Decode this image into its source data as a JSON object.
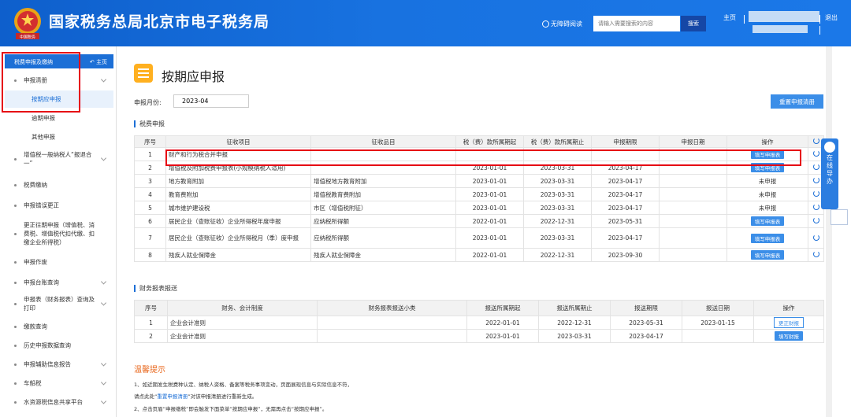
{
  "header": {
    "title": "国家税务总局北京市电子税务局",
    "emblem_text": "中国税务",
    "accessibility": "无障碍阅读",
    "search_placeholder": "请输入需要搜索的内容",
    "search_button": "搜索",
    "home": "主页",
    "logout": "退出"
  },
  "sidebar": {
    "head": "税费申报及缴纳",
    "home": "主页",
    "items": [
      {
        "label": "申报清册",
        "chevron": true
      },
      {
        "label": "增值税一般纳税人“报退合一”",
        "chevron": true
      },
      {
        "label": "税费缴纳",
        "chevron": false
      },
      {
        "label": "申报错误更正",
        "chevron": false
      },
      {
        "label": "更正往期申报（增值税、消费税、增值税代扣代缴、扣缴企业所得税）",
        "chevron": false
      },
      {
        "label": "申报作废",
        "chevron": false
      },
      {
        "label": "申报台账查询",
        "chevron": true
      },
      {
        "label": "申报表（财务报表）查询及打印",
        "chevron": true
      },
      {
        "label": "缴款查询",
        "chevron": false
      },
      {
        "label": "历史申报数据查询",
        "chevron": false
      },
      {
        "label": "申报辅助信息报告",
        "chevron": true
      },
      {
        "label": "车船税",
        "chevron": true
      },
      {
        "label": "水资源税信息共享平台",
        "chevron": true
      }
    ],
    "subitems": [
      "按期应申报",
      "逾期申报",
      "其他申报"
    ]
  },
  "main": {
    "title": "按期应申报",
    "month_label": "申报月份:",
    "month_value": "2023-04",
    "reset_button": "重置申报清册",
    "tax_section": "税费申报",
    "tax_headers": [
      "序号",
      "征收项目",
      "征收品目",
      "税（费）款所属期起",
      "税（费）款所属期止",
      "申报期限",
      "申报日期",
      "操作"
    ],
    "tax_rows": [
      {
        "no": "1",
        "item": "财产和行为税合并申报",
        "sub": "",
        "start": "",
        "end": "",
        "deadline": "",
        "date": "",
        "op": "填写申报表",
        "op_type": "button"
      },
      {
        "no": "2",
        "item": "增值税及附加税费申报表(小规模纳税人适用)",
        "sub": "",
        "start": "2023-01-01",
        "end": "2023-03-31",
        "deadline": "2023-04-17",
        "date": "",
        "op": "填写申报表",
        "op_type": "button"
      },
      {
        "no": "3",
        "item": "地方教育附加",
        "sub": "增值税地方教育附加",
        "start": "2023-01-01",
        "end": "2023-03-31",
        "deadline": "2023-04-17",
        "date": "",
        "op": "未申报",
        "op_type": "text"
      },
      {
        "no": "4",
        "item": "教育费附加",
        "sub": "增值税教育费附加",
        "start": "2023-01-01",
        "end": "2023-03-31",
        "deadline": "2023-04-17",
        "date": "",
        "op": "未申报",
        "op_type": "text"
      },
      {
        "no": "5",
        "item": "城市维护建设税",
        "sub": "市区（增值税附征）",
        "start": "2023-01-01",
        "end": "2023-03-31",
        "deadline": "2023-04-17",
        "date": "",
        "op": "未申报",
        "op_type": "text"
      },
      {
        "no": "6",
        "item": "居民企业（查账征收）企业所得税年度申报",
        "sub": "应纳税所得额",
        "start": "2022-01-01",
        "end": "2022-12-31",
        "deadline": "2023-05-31",
        "date": "",
        "op": "填写申报表",
        "op_type": "button"
      },
      {
        "no": "7",
        "item": "居民企业（查账征收）企业所得税月（季）度申报",
        "sub": "应纳税所得额",
        "start": "2023-01-01",
        "end": "2023-03-31",
        "deadline": "2023-04-17",
        "date": "",
        "op": "填写申报表",
        "op_type": "button"
      },
      {
        "no": "8",
        "item": "残疾人就业保障金",
        "sub": "残疾人就业保障金",
        "start": "2022-01-01",
        "end": "2022-12-31",
        "deadline": "2023-09-30",
        "date": "",
        "op": "填写申报表",
        "op_type": "button"
      }
    ],
    "fin_section": "财务报表报送",
    "fin_headers": [
      "序号",
      "财务、会计制度",
      "财务报表报送小类",
      "报送所属期起",
      "报送所属期止",
      "报送期限",
      "报送日期",
      "操作"
    ],
    "fin_rows": [
      {
        "no": "1",
        "system": "企业会计准则",
        "sub": "",
        "start": "2022-01-01",
        "end": "2022-12-31",
        "deadline": "2023-05-31",
        "date": "2023-01-15",
        "op": "更正财报",
        "op_type": "outline"
      },
      {
        "no": "2",
        "system": "企业会计准则",
        "sub": "",
        "start": "2023-01-01",
        "end": "2023-03-31",
        "deadline": "2023-04-17",
        "date": "",
        "op": "填写财报",
        "op_type": "button"
      }
    ],
    "tips_title": "温馨提示",
    "tips": [
      {
        "pre": "1、如近期发生税费种认定、纳税人资格、备案等税务事项变动，页面展现信息与实际信息不符，",
        "link": "",
        "post": ""
      },
      {
        "pre": "请点此处“",
        "link": "重置申报清册",
        "post": "”对该申报清册进行重新生成。"
      },
      {
        "pre": "2、点击页眉“申报缴税”即会触发下面菜单“按期应申报”，无需再点击“按期应申报”。",
        "link": "",
        "post": ""
      }
    ]
  },
  "float_widget": {
    "label": "在线导办"
  }
}
